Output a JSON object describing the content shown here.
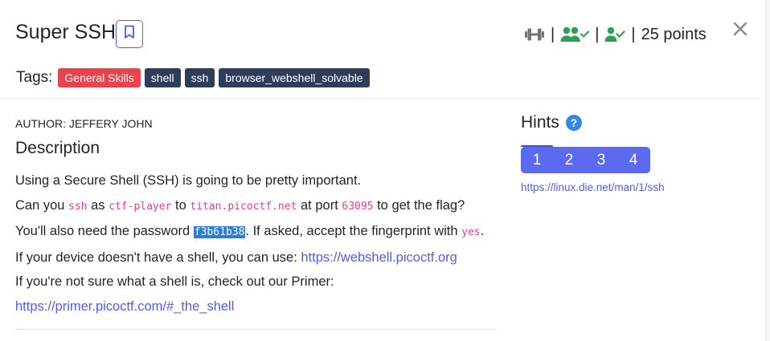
{
  "challenge": {
    "title": "Super SSH",
    "points_text": "25 points",
    "separator": "|"
  },
  "tags": {
    "label": "Tags:",
    "items": [
      {
        "label": "General Skills",
        "color": "#e9434b"
      },
      {
        "label": "shell",
        "color": "#2d3d5a"
      },
      {
        "label": "ssh",
        "color": "#2d3d5a"
      },
      {
        "label": "browser_webshell_solvable",
        "color": "#2d3d5a"
      }
    ]
  },
  "content": {
    "author": "AUTHOR: JEFFERY JOHN",
    "description_heading": "Description",
    "line1": "Using a Secure Shell (SSH) is going to be pretty important.",
    "line2_a": "Can you ",
    "line2_code1": "ssh",
    "line2_b": " as ",
    "line2_code2": "ctf-player",
    "line2_c": " to ",
    "line2_code3": "titan.picoctf.net",
    "line2_d": " at port ",
    "line2_code4": "63095",
    "line2_e": " to get the flag?",
    "line3_a": "You'll also need the password ",
    "line3_code": "f3b61b38",
    "line3_b": ". If asked, accept the fingerprint with ",
    "line3_code2": "yes",
    "line3_c": ".",
    "line4_a": "If your device doesn't have a shell, you can use: ",
    "line4_link": "https://webshell.picoctf.org",
    "line5": "If you're not sure what a shell is, check out our Primer:",
    "line6_link": "https://primer.picoctf.com/#_the_shell"
  },
  "hints": {
    "heading": "Hints",
    "help_symbol": "?",
    "tabs": [
      "1",
      "2",
      "3",
      "4"
    ],
    "active_tab": "1",
    "link": "https://linux.die.net/man/1/ssh"
  },
  "icons": {
    "bookmark": "bookmark-icon",
    "close": "close-icon",
    "difficulty": "dumbbell-icon",
    "solves": "users-check-icon",
    "solved": "user-check-icon"
  },
  "colors": {
    "accent": "#5b6af0",
    "link": "#4f5ef0",
    "stat_green": "#2e9e54",
    "code_pink": "#e83e8c",
    "selection": "#2f7bdc"
  }
}
